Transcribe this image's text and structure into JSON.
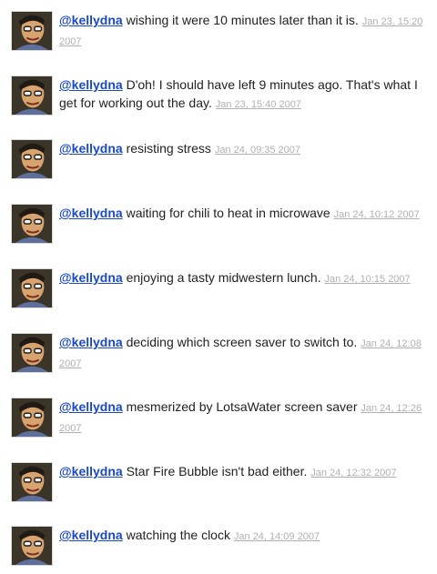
{
  "tweets": [
    {
      "user": "@kellydna",
      "text": "wishing it were 10 minutes later than it is.",
      "time": "Jan 23, 15:20 2007"
    },
    {
      "user": "@kellydna",
      "text": "D'oh! I should have left 9 minutes ago. That's what I get for working out the day.",
      "time": "Jan 23, 15:40 2007"
    },
    {
      "user": "@kellydna",
      "text": "resisting stress",
      "time": "Jan 24, 09:35 2007"
    },
    {
      "user": "@kellydna",
      "text": "waiting for chili to heat in microwave",
      "time": "Jan 24, 10:12 2007"
    },
    {
      "user": "@kellydna",
      "text": "enjoying a tasty midwestern lunch.",
      "time": "Jan 24, 10:15 2007"
    },
    {
      "user": "@kellydna",
      "text": "deciding which screen saver to switch to.",
      "time": "Jan 24, 12:08 2007"
    },
    {
      "user": "@kellydna",
      "text": "mesmerized by LotsaWater screen saver",
      "time": "Jan 24, 12:26 2007"
    },
    {
      "user": "@kellydna",
      "text": "Star Fire Bubble isn't bad either.",
      "time": "Jan 24, 12:32 2007"
    },
    {
      "user": "@kellydna",
      "text": "watching the clock",
      "time": "Jan 24, 14:09 2007"
    }
  ],
  "colors": {
    "link": "#1a49c7",
    "timestamp": "#b0b0b0",
    "text": "#222222"
  },
  "icons": {
    "avatar": "user-avatar-photo"
  }
}
